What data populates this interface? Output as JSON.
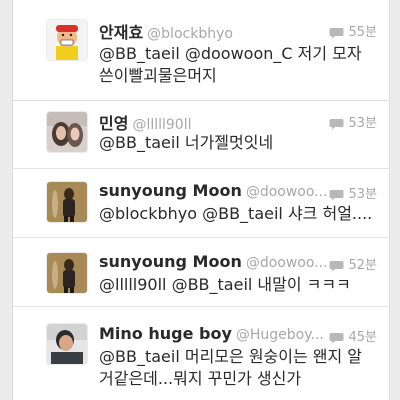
{
  "tweets": [
    {
      "name": "안재효",
      "handle": "@blockbhyo",
      "time": "55분",
      "text": "@BB_taeil @doowoon_C 저기 모자쓴이빨괴물은머지",
      "avatar": "avatar-yellow-character"
    },
    {
      "name": "민영",
      "handle": "@lllll90ll",
      "time": "53분",
      "text": "@BB_taeil 너가젤멋잇네",
      "avatar": "avatar-photo-girl"
    },
    {
      "name": "sunyoung Moon",
      "handle": "@doowoo...",
      "time": "53분",
      "text": "@blockbhyo @BB_taeil 샤크 허얼....",
      "avatar": "avatar-photo-dark"
    },
    {
      "name": "sunyoung Moon",
      "handle": "@doowoo...",
      "time": "52분",
      "text": "@lllll90ll @BB_taeil 내말이 ㅋㅋㅋ",
      "avatar": "avatar-photo-dark"
    },
    {
      "name": "Mino huge boy",
      "handle": "@Hugeboy...",
      "time": "45분",
      "text": "@BB_taeil 머리모은 원숭이는 왠지 알거같은데...뭐지 꾸민가 생신가",
      "avatar": "avatar-photo-boy"
    }
  ],
  "colors": {
    "reply_icon": "#b8b8b8",
    "name": "#2a2a2a",
    "muted": "#a8a8a8"
  }
}
